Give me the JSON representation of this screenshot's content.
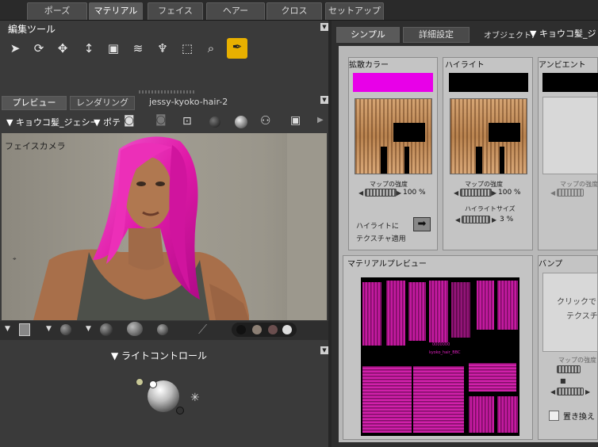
{
  "top_tabs": [
    "ポーズ",
    "マテリアル",
    "フェイス",
    "ヘアー",
    "クロス",
    "セットアップ"
  ],
  "active_top_tab": "マテリアル",
  "editing_tools": {
    "title": "編集ツール",
    "icons": [
      "pointer-icon",
      "rotate-icon",
      "move-icon",
      "translate-icon",
      "scale-icon",
      "taper-icon",
      "grab-icon",
      "select-region-icon",
      "zoom-icon",
      "eyedropper-icon"
    ]
  },
  "preview": {
    "tabs": [
      "プレビュー",
      "レンダリング"
    ],
    "file_name": "jessy-kyoko-hair-2",
    "figure_select": "キョウコ髪_ジェシー",
    "camera_select": "ポテ",
    "camera_label": "フェイスカメラ"
  },
  "light_control": {
    "title": "ライトコントロール"
  },
  "right": {
    "tabs": [
      "シンプル",
      "詳細設定"
    ],
    "object_label": "オブジェクト:",
    "object_value": "キョウコ髪_ジ",
    "diffuse": {
      "label": "拡散カラー",
      "color": "#e800e8",
      "map_strength_label": "マップの強度",
      "map_strength_value": "100 %"
    },
    "highlight": {
      "label": "ハイライト",
      "color": "#000000",
      "map_strength_label": "マップの強度",
      "map_strength_value": "100 %",
      "size_label": "ハイライトサイズ",
      "size_value": "3 %",
      "apply_texture_label_1": "ハイライトに",
      "apply_texture_label_2": "テクスチャ適用"
    },
    "ambient": {
      "label": "アンビエント",
      "color": "#000000",
      "map_strength_label": "マップの強度"
    },
    "material_preview": {
      "label": "マテリアルプレビュー",
      "texture_text_1": "0000000",
      "texture_text_2": "kyoko_hair_BBC"
    },
    "bump": {
      "label": "バンプ",
      "click_text_1": "クリックで",
      "click_text_2": "テクスチ",
      "map_strength_label": "マップの強度",
      "replace_label": "置き換え"
    }
  }
}
